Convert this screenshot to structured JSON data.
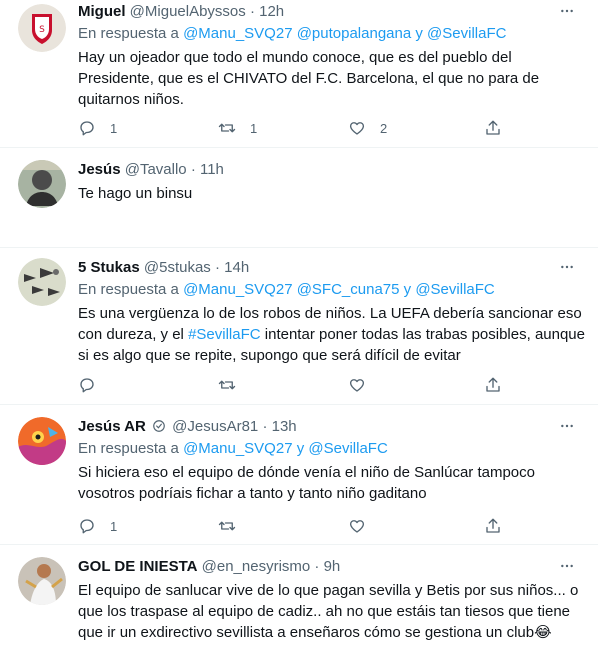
{
  "icons": {
    "reply": "reply-icon",
    "retweet": "retweet-icon",
    "like": "heart-icon",
    "share": "share-icon",
    "more": "more-icon"
  },
  "colors": {
    "link": "#1d9bf0",
    "secondary": "#536471",
    "text": "#0f1419"
  },
  "tweets": [
    {
      "name": "Miguel",
      "handle": "@MiguelAbyssos",
      "dot": "·",
      "time": "12h",
      "reply_prefix": "En respuesta a",
      "mention_1": "@Manu_SVQ27",
      "mention_2": "@putopalangana",
      "conj": "y",
      "mention_3": "@SevillaFC",
      "text": "Hay un ojeador que todo el mundo conoce, que es del pueblo del Presidente, que es el CHIVATO del F.C. Barcelona, el que no para de quitarnos niños.",
      "replies": "1",
      "retweets": "1",
      "likes": "2"
    },
    {
      "name": "Jesús",
      "handle": "@Tavallo",
      "dot": "·",
      "time": "11h",
      "text": "Te hago un binsu"
    },
    {
      "name": "5 Stukas",
      "handle": "@5stukas",
      "dot": "·",
      "time": "14h",
      "reply_prefix": "En respuesta a",
      "mention_1": "@Manu_SVQ27",
      "mention_2": "@SFC_cuna75",
      "conj": "y",
      "mention_3": "@SevillaFC",
      "text_a": "Es una vergüenza lo de los robos de niños. La UEFA debería sancionar eso con dureza, y el",
      "hashtag": "#SevillaFC",
      "text_b": "intentar poner todas las trabas posibles, aunque si es algo que se repite, supongo que será difícil de evitar"
    },
    {
      "name": "Jesús AR",
      "handle": "@JesusAr81",
      "dot": "·",
      "time": "13h",
      "reply_prefix": "En respuesta a",
      "mention_1": "@Manu_SVQ27",
      "conj": "y",
      "mention_2": "@SevillaFC",
      "text": "Si hiciera eso el equipo de dónde venía el niño de Sanlúcar tampoco vosotros podríais fichar a tanto y tanto niño gaditano",
      "replies": "1"
    },
    {
      "name": "GOL DE INIESTA",
      "handle": "@en_nesyrismo",
      "dot": "·",
      "time": "9h",
      "text": "El equipo de sanlucar vive de lo que pagan sevilla y Betis por sus niños... o que los traspase al equipo de cadiz.. ah no que estáis tan tiesos que tiene que ir un exdirectivo sevillista a enseñaros cómo se gestiona un club",
      "emoji": "😂"
    }
  ]
}
